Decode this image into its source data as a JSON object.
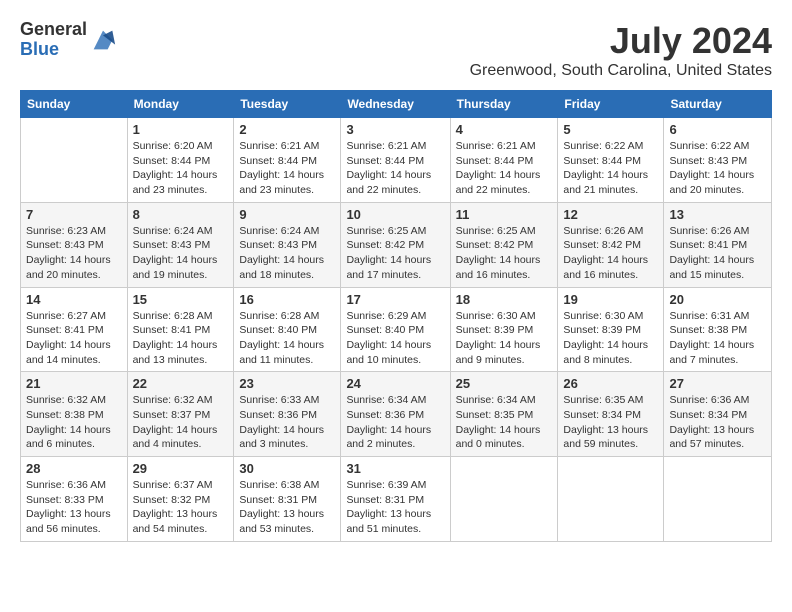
{
  "logo": {
    "general": "General",
    "blue": "Blue"
  },
  "title": {
    "month_year": "July 2024",
    "location": "Greenwood, South Carolina, United States"
  },
  "days_of_week": [
    "Sunday",
    "Monday",
    "Tuesday",
    "Wednesday",
    "Thursday",
    "Friday",
    "Saturday"
  ],
  "weeks": [
    [
      {
        "day": "",
        "info": ""
      },
      {
        "day": "1",
        "info": "Sunrise: 6:20 AM\nSunset: 8:44 PM\nDaylight: 14 hours\nand 23 minutes."
      },
      {
        "day": "2",
        "info": "Sunrise: 6:21 AM\nSunset: 8:44 PM\nDaylight: 14 hours\nand 23 minutes."
      },
      {
        "day": "3",
        "info": "Sunrise: 6:21 AM\nSunset: 8:44 PM\nDaylight: 14 hours\nand 22 minutes."
      },
      {
        "day": "4",
        "info": "Sunrise: 6:21 AM\nSunset: 8:44 PM\nDaylight: 14 hours\nand 22 minutes."
      },
      {
        "day": "5",
        "info": "Sunrise: 6:22 AM\nSunset: 8:44 PM\nDaylight: 14 hours\nand 21 minutes."
      },
      {
        "day": "6",
        "info": "Sunrise: 6:22 AM\nSunset: 8:43 PM\nDaylight: 14 hours\nand 20 minutes."
      }
    ],
    [
      {
        "day": "7",
        "info": "Sunrise: 6:23 AM\nSunset: 8:43 PM\nDaylight: 14 hours\nand 20 minutes."
      },
      {
        "day": "8",
        "info": "Sunrise: 6:24 AM\nSunset: 8:43 PM\nDaylight: 14 hours\nand 19 minutes."
      },
      {
        "day": "9",
        "info": "Sunrise: 6:24 AM\nSunset: 8:43 PM\nDaylight: 14 hours\nand 18 minutes."
      },
      {
        "day": "10",
        "info": "Sunrise: 6:25 AM\nSunset: 8:42 PM\nDaylight: 14 hours\nand 17 minutes."
      },
      {
        "day": "11",
        "info": "Sunrise: 6:25 AM\nSunset: 8:42 PM\nDaylight: 14 hours\nand 16 minutes."
      },
      {
        "day": "12",
        "info": "Sunrise: 6:26 AM\nSunset: 8:42 PM\nDaylight: 14 hours\nand 16 minutes."
      },
      {
        "day": "13",
        "info": "Sunrise: 6:26 AM\nSunset: 8:41 PM\nDaylight: 14 hours\nand 15 minutes."
      }
    ],
    [
      {
        "day": "14",
        "info": "Sunrise: 6:27 AM\nSunset: 8:41 PM\nDaylight: 14 hours\nand 14 minutes."
      },
      {
        "day": "15",
        "info": "Sunrise: 6:28 AM\nSunset: 8:41 PM\nDaylight: 14 hours\nand 13 minutes."
      },
      {
        "day": "16",
        "info": "Sunrise: 6:28 AM\nSunset: 8:40 PM\nDaylight: 14 hours\nand 11 minutes."
      },
      {
        "day": "17",
        "info": "Sunrise: 6:29 AM\nSunset: 8:40 PM\nDaylight: 14 hours\nand 10 minutes."
      },
      {
        "day": "18",
        "info": "Sunrise: 6:30 AM\nSunset: 8:39 PM\nDaylight: 14 hours\nand 9 minutes."
      },
      {
        "day": "19",
        "info": "Sunrise: 6:30 AM\nSunset: 8:39 PM\nDaylight: 14 hours\nand 8 minutes."
      },
      {
        "day": "20",
        "info": "Sunrise: 6:31 AM\nSunset: 8:38 PM\nDaylight: 14 hours\nand 7 minutes."
      }
    ],
    [
      {
        "day": "21",
        "info": "Sunrise: 6:32 AM\nSunset: 8:38 PM\nDaylight: 14 hours\nand 6 minutes."
      },
      {
        "day": "22",
        "info": "Sunrise: 6:32 AM\nSunset: 8:37 PM\nDaylight: 14 hours\nand 4 minutes."
      },
      {
        "day": "23",
        "info": "Sunrise: 6:33 AM\nSunset: 8:36 PM\nDaylight: 14 hours\nand 3 minutes."
      },
      {
        "day": "24",
        "info": "Sunrise: 6:34 AM\nSunset: 8:36 PM\nDaylight: 14 hours\nand 2 minutes."
      },
      {
        "day": "25",
        "info": "Sunrise: 6:34 AM\nSunset: 8:35 PM\nDaylight: 14 hours\nand 0 minutes."
      },
      {
        "day": "26",
        "info": "Sunrise: 6:35 AM\nSunset: 8:34 PM\nDaylight: 13 hours\nand 59 minutes."
      },
      {
        "day": "27",
        "info": "Sunrise: 6:36 AM\nSunset: 8:34 PM\nDaylight: 13 hours\nand 57 minutes."
      }
    ],
    [
      {
        "day": "28",
        "info": "Sunrise: 6:36 AM\nSunset: 8:33 PM\nDaylight: 13 hours\nand 56 minutes."
      },
      {
        "day": "29",
        "info": "Sunrise: 6:37 AM\nSunset: 8:32 PM\nDaylight: 13 hours\nand 54 minutes."
      },
      {
        "day": "30",
        "info": "Sunrise: 6:38 AM\nSunset: 8:31 PM\nDaylight: 13 hours\nand 53 minutes."
      },
      {
        "day": "31",
        "info": "Sunrise: 6:39 AM\nSunset: 8:31 PM\nDaylight: 13 hours\nand 51 minutes."
      },
      {
        "day": "",
        "info": ""
      },
      {
        "day": "",
        "info": ""
      },
      {
        "day": "",
        "info": ""
      }
    ]
  ]
}
